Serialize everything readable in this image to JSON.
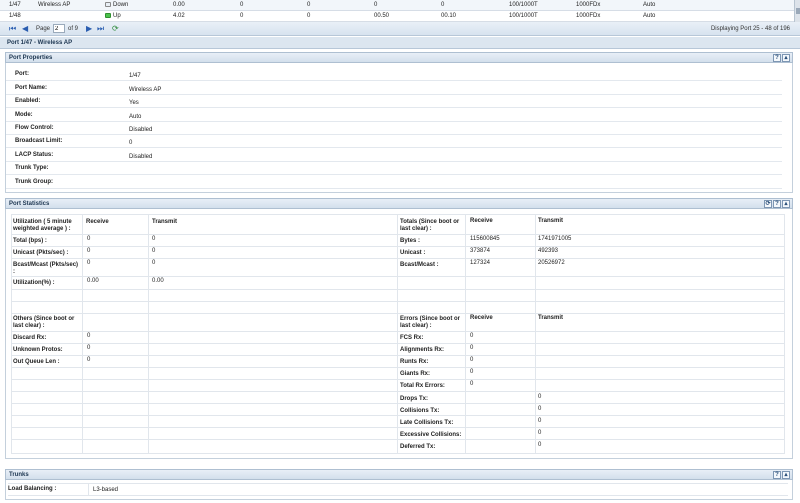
{
  "top_rows": [
    {
      "port": "1/47",
      "name": "Wireless AP",
      "status": "Down",
      "c1": "0.00",
      "c2": "0",
      "c3": "0",
      "c4": "0",
      "c5": "0",
      "speed": "100/1000T",
      "duplex": "1000FDx",
      "mode": "Auto"
    },
    {
      "port": "1/48",
      "name": "",
      "status": "Up",
      "c1": "4.02",
      "c2": "0",
      "c3": "0",
      "c4": "00.50",
      "c5": "00.10",
      "speed": "100/1000T",
      "duplex": "1000FDx",
      "mode": "Auto"
    }
  ],
  "pager": {
    "page_label": "Page",
    "page_value": "2",
    "of_label": "of 9",
    "display_text": "Displaying Port 25 - 48 of 196"
  },
  "page_title": "Port 1/47 - Wireless AP",
  "port_properties": {
    "title": "Port Properties",
    "rows": [
      {
        "label": "Port:",
        "value": "1/47"
      },
      {
        "label": "Port Name:",
        "value": "Wireless AP"
      },
      {
        "label": "Enabled:",
        "value": "Yes"
      },
      {
        "label": "Mode:",
        "value": "Auto"
      },
      {
        "label": "Flow Control:",
        "value": "Disabled"
      },
      {
        "label": "Broadcast Limit:",
        "value": "0"
      },
      {
        "label": "LACP Status:",
        "value": "Disabled"
      },
      {
        "label": "Trunk Type:",
        "value": ""
      },
      {
        "label": "Trunk Group:",
        "value": ""
      }
    ]
  },
  "port_statistics": {
    "title": "Port Statistics",
    "utilization": {
      "header": "Utilization ( 5 minute weighted average ) :",
      "receive": "Receive",
      "transmit": "Transmit",
      "rows": [
        {
          "label": "Total (bps) :",
          "rx": "0",
          "tx": "0"
        },
        {
          "label": "Unicast (Pkts/sec) :",
          "rx": "0",
          "tx": "0"
        },
        {
          "label": "Bcast/Mcast (Pkts/sec) :",
          "rx": "0",
          "tx": "0"
        },
        {
          "label": "Utilization(%) :",
          "rx": "0.00",
          "tx": "0.00"
        }
      ]
    },
    "totals": {
      "header": "Totals (Since boot or last clear) :",
      "receive": "Receive",
      "transmit": "Transmit",
      "rows": [
        {
          "label": "Bytes :",
          "rx": "115600845",
          "tx": "1741971005"
        },
        {
          "label": "Unicast :",
          "rx": "373874",
          "tx": "492393"
        },
        {
          "label": "Bcast/Mcast :",
          "rx": "127324",
          "tx": "20526972"
        }
      ]
    },
    "others": {
      "header": "Others (Since boot or last clear) :",
      "rows": [
        {
          "label": "Discard Rx:",
          "value": "0"
        },
        {
          "label": "Unknown Protos:",
          "value": "0"
        },
        {
          "label": "Out Queue Len :",
          "value": "0"
        }
      ]
    },
    "errors": {
      "header": "Errors (Since boot or last clear) :",
      "receive": "Receive",
      "transmit": "Transmit",
      "rx_rows": [
        {
          "label": "FCS Rx:",
          "value": "0"
        },
        {
          "label": "Alignments Rx:",
          "value": "0"
        },
        {
          "label": "Runts Rx:",
          "value": "0"
        },
        {
          "label": "Giants Rx:",
          "value": "0"
        },
        {
          "label": "Total Rx Errors:",
          "value": "0"
        }
      ],
      "tx_rows": [
        {
          "label": "Drops Tx:",
          "value": "0"
        },
        {
          "label": "Collisions Tx:",
          "value": "0"
        },
        {
          "label": "Late Collisions Tx:",
          "value": "0"
        },
        {
          "label": "Excessive Collisions:",
          "value": "0"
        },
        {
          "label": "Deferred Tx:",
          "value": "0"
        }
      ]
    }
  },
  "trunks": {
    "title": "Trunks",
    "label": "Load Balancing :",
    "value": "L3-based"
  },
  "icons": {
    "first": "first-page-icon",
    "prev": "prev-page-icon",
    "next": "next-page-icon",
    "last": "last-page-icon",
    "refresh": "refresh-icon",
    "help": "help-icon",
    "collapse": "collapse-icon"
  },
  "colors": {
    "status_up": "#4cc24c",
    "header_bg": "#dce6f0",
    "link_blue": "#2a5db0"
  }
}
